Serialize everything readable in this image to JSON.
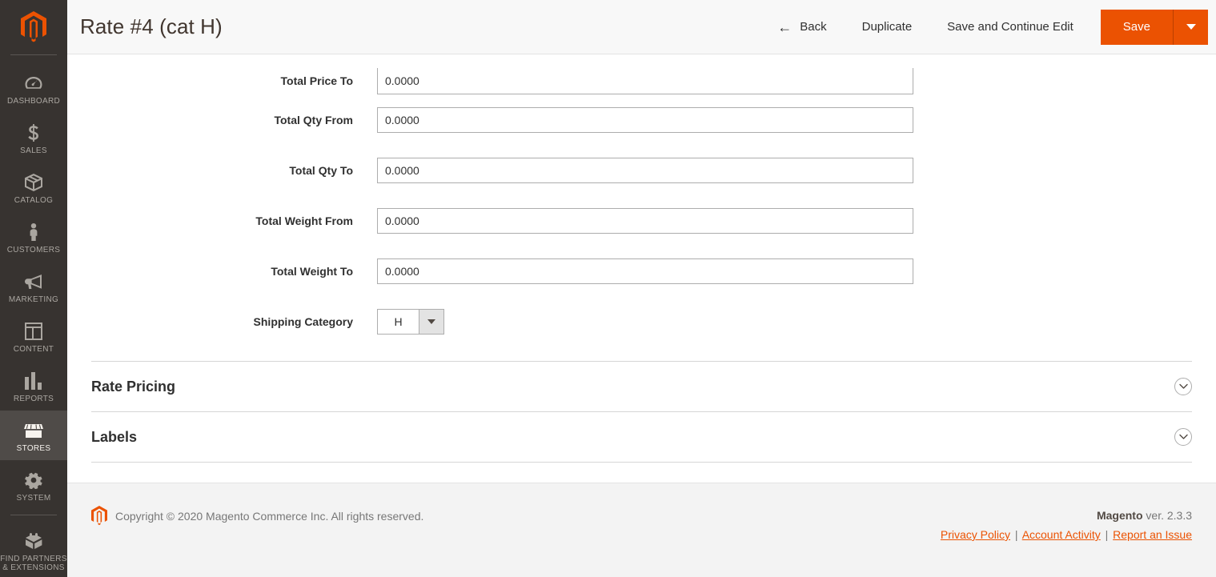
{
  "sidebar": {
    "logo_icon": "magento-logo-icon",
    "items": [
      {
        "label": "DASHBOARD",
        "icon": "dashboard-gauge-icon",
        "active": false
      },
      {
        "label": "SALES",
        "icon": "dollar-sign-icon",
        "active": false
      },
      {
        "label": "CATALOG",
        "icon": "box-icon",
        "active": false
      },
      {
        "label": "CUSTOMERS",
        "icon": "person-icon",
        "active": false
      },
      {
        "label": "MARKETING",
        "icon": "megaphone-icon",
        "active": false
      },
      {
        "label": "CONTENT",
        "icon": "layout-panel-icon",
        "active": false
      },
      {
        "label": "REPORTS",
        "icon": "bar-chart-icon",
        "active": false
      },
      {
        "label": "STORES",
        "icon": "storefront-icon",
        "active": true
      },
      {
        "label": "SYSTEM",
        "icon": "gear-icon",
        "active": false
      },
      {
        "label": "FIND PARTNERS\n& EXTENSIONS",
        "icon": "brick-block-icon",
        "active": false
      }
    ]
  },
  "header": {
    "title": "Rate #4 (cat H)",
    "back_label": "Back",
    "back_icon": "arrow-left-icon",
    "duplicate_label": "Duplicate",
    "save_continue_label": "Save and Continue Edit",
    "save_label": "Save",
    "save_toggle_icon": "caret-down-icon",
    "accent_color": "#eb5202"
  },
  "form": {
    "fields": [
      {
        "label": "Total Price To",
        "value": "0.0000",
        "type": "text"
      },
      {
        "label": "Total Qty From",
        "value": "0.0000",
        "type": "text"
      },
      {
        "label": "Total Qty To",
        "value": "0.0000",
        "type": "text"
      },
      {
        "label": "Total Weight From",
        "value": "0.0000",
        "type": "text"
      },
      {
        "label": "Total Weight To",
        "value": "0.0000",
        "type": "text"
      }
    ],
    "shipping_category": {
      "label": "Shipping Category",
      "value": "H",
      "toggle_icon": "select-arrow-down-icon"
    }
  },
  "sections": [
    {
      "title": "Rate Pricing",
      "toggle_icon": "chevron-down-circle-icon",
      "expanded": false
    },
    {
      "title": "Labels",
      "toggle_icon": "chevron-down-circle-icon",
      "expanded": false
    }
  ],
  "footer": {
    "logo_icon": "magento-logo-icon",
    "copyright": "Copyright © 2020 Magento Commerce Inc. All rights reserved.",
    "brand": "Magento",
    "version": "ver. 2.3.3",
    "links": [
      {
        "label": "Privacy Policy"
      },
      {
        "label": " Account Activity"
      },
      {
        "label": "Report an Issue"
      }
    ],
    "link_separator": "|",
    "link_color": "#eb5202"
  }
}
